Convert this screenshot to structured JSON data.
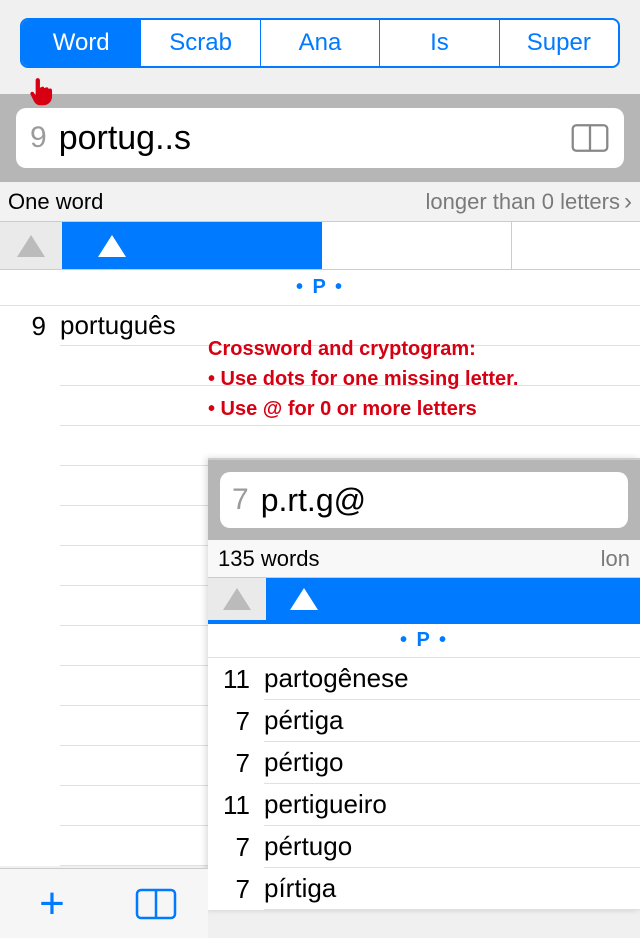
{
  "tabs": [
    "Word",
    "Scrab",
    "Ana",
    "Is",
    "Super"
  ],
  "activeTab": 0,
  "search": {
    "lengthHint": "9",
    "value": "portug..s"
  },
  "filter": {
    "left": "One word",
    "right": "longer than 0 letters"
  },
  "sectionHeader": "•  P  •",
  "results": [
    {
      "len": "9",
      "word": "português"
    }
  ],
  "annotation": {
    "l1": "Crossword and cryptogram:",
    "l2": "• Use dots for one missing letter.",
    "l3": "• Use @ for 0 or more letters"
  },
  "overlay": {
    "search": {
      "lengthHint": "7",
      "value": "p.rt.g@"
    },
    "filter": {
      "left": "135 words",
      "right": "lon"
    },
    "sectionHeader": "•  P  •",
    "results": [
      {
        "len": "11",
        "word": "partogênese"
      },
      {
        "len": "7",
        "word": "pértiga"
      },
      {
        "len": "7",
        "word": "pértigo"
      },
      {
        "len": "11",
        "word": "pertigueiro"
      },
      {
        "len": "7",
        "word": "pértugo"
      },
      {
        "len": "7",
        "word": "pírtiga"
      }
    ]
  }
}
